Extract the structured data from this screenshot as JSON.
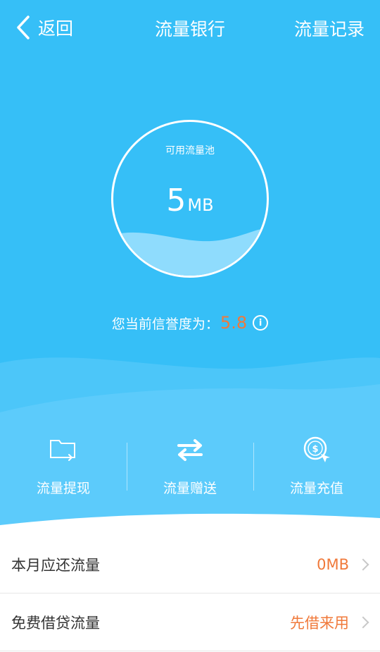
{
  "nav": {
    "back_label": "返回",
    "title": "流量银行",
    "records_label": "流量记录"
  },
  "pool": {
    "label": "可用流量池",
    "value": "5",
    "unit": "MB"
  },
  "credit": {
    "prefix": "您当前信誉度为：",
    "score": "5.8"
  },
  "actions": [
    {
      "label": "流量提现",
      "icon": "folder-export-icon"
    },
    {
      "label": "流量赠送",
      "icon": "transfer-arrows-icon"
    },
    {
      "label": "流量充值",
      "icon": "coin-recharge-icon"
    }
  ],
  "list": [
    {
      "label": "本月应还流量",
      "value": "0MB"
    },
    {
      "label": "免费借贷流量",
      "value": "先借来用"
    }
  ],
  "colors": {
    "primary": "#36bff7",
    "accent": "#f0793a",
    "wave_light": "#5ccbfb"
  }
}
